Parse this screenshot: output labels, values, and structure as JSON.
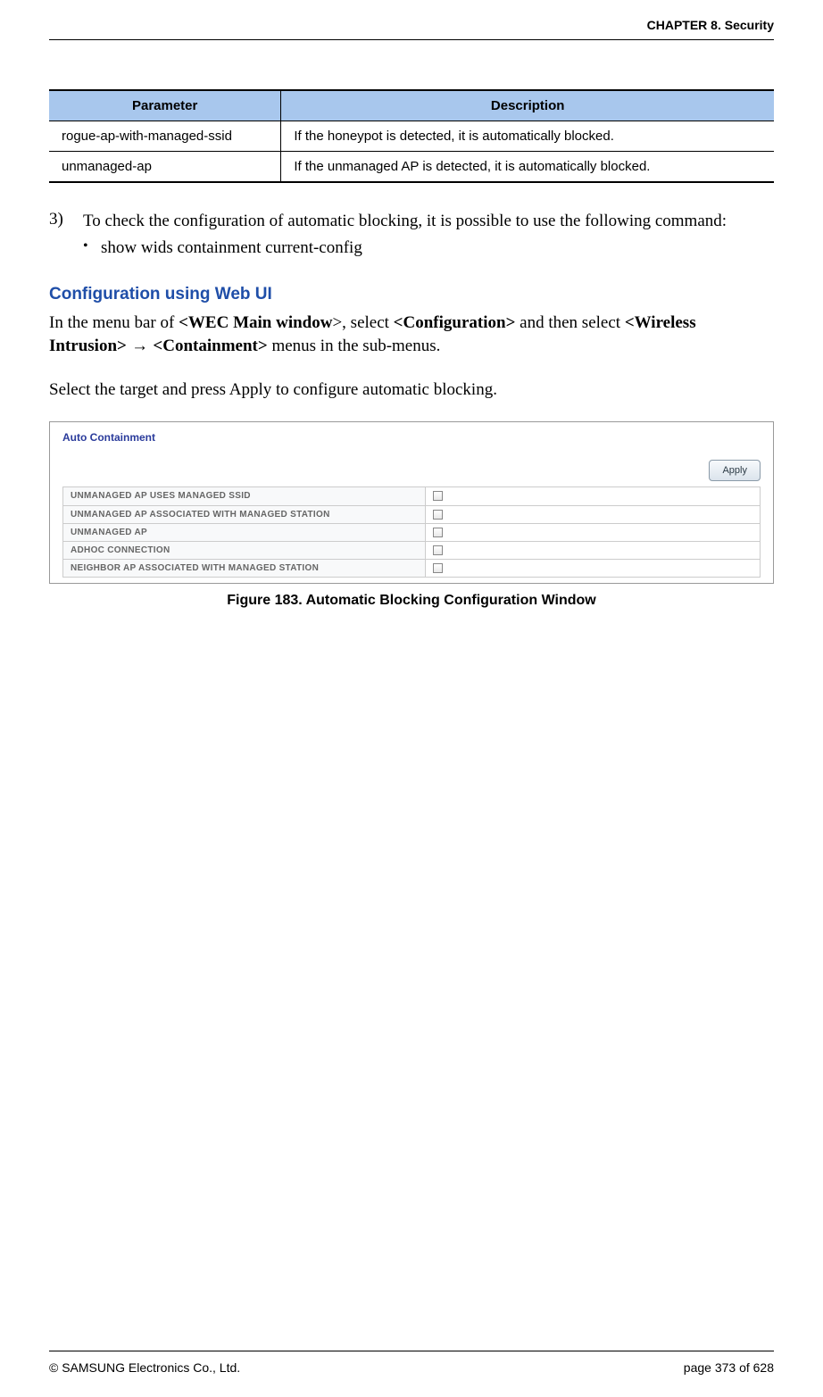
{
  "header": {
    "chapter": "CHAPTER 8. Security"
  },
  "param_table": {
    "headers": {
      "p": "Parameter",
      "d": "Description"
    },
    "rows": [
      {
        "p": "rogue-ap-with-managed-ssid",
        "d": "If the honeypot is detected, it is automatically blocked."
      },
      {
        "p": "unmanaged-ap",
        "d": "If the unmanaged AP is detected, it is automatically blocked."
      }
    ]
  },
  "step3": {
    "num": "3)",
    "text": "To check the configuration of automatic blocking, it is possible to use the following command:",
    "bullet_glyph": "•",
    "bullet_text": "show wids containment current-config"
  },
  "section": {
    "heading": "Configuration using Web UI",
    "p1_a": "In the menu bar of ",
    "p1_b": "<WEC Main window",
    "p1_c": ">, select ",
    "p1_d": "<Configuration>",
    "p1_e": " and then select ",
    "p1_f": "<Wireless Intrusion>",
    "p1_g": " → ",
    "p1_h": "<Containment>",
    "p1_i": " menus in the sub-menus.",
    "p2": "Select the target and press Apply to configure automatic blocking."
  },
  "figure": {
    "panel_title": "Auto Containment",
    "apply_label": "Apply",
    "rows": [
      "UNMANAGED AP USES MANAGED SSID",
      "UNMANAGED AP ASSOCIATED WITH MANAGED STATION",
      "UNMANAGED AP",
      "ADHOC CONNECTION",
      "NEIGHBOR AP ASSOCIATED WITH MANAGED STATION"
    ],
    "caption": "Figure 183. Automatic Blocking Configuration Window"
  },
  "footer": {
    "copyright": "© SAMSUNG Electronics Co., Ltd.",
    "page": "page 373 of 628"
  }
}
